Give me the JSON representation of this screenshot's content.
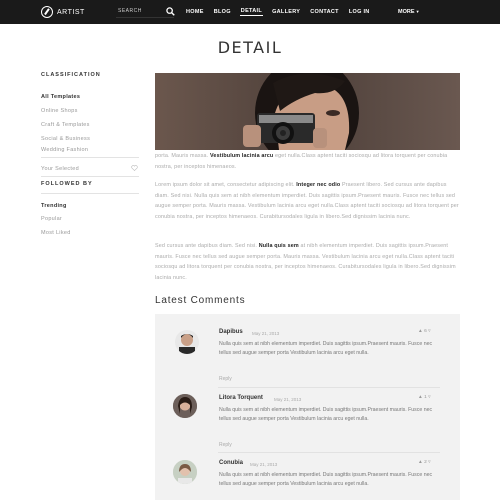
{
  "header": {
    "logo_text": "ARTIST",
    "search_label": "SEARCH",
    "nav": [
      "HOME",
      "BLOG",
      "DETAIL",
      "GALLERY",
      "CONTACT",
      "LOG IN"
    ],
    "more": "MORE",
    "accent": "#1a1a1a"
  },
  "page_title": "DETAIL",
  "sidebar": {
    "classification_heading": "CLASSIFICATION",
    "classification_items": [
      "All Templates",
      "Online Shops",
      "Craft & Templates",
      "Social & Business",
      "Wedding Fashion"
    ],
    "your_selected": "Your Selected",
    "followed_heading": "FOLLOWED BY",
    "followed_items": [
      "Trending",
      "Popular",
      "Most Liked"
    ]
  },
  "article": {
    "p1_lead": "porta. Mauris massa. ",
    "p1_bold": "Vestibulum lacinia arcu",
    "p1_rest": " eget nulla.Class aptent taciti sociosqu ad litora torquent per conubia nostra, per inceptos himenaeos.",
    "p2_lead": "Lorem ipsum dolor sit amet, consectetur adipiscing elit. ",
    "p2_bold": "Integer nec odio",
    "p2_rest": " Praesent libero. Sed cursus ante dapibus diam. Sed nisi. Nulla quis sem at nibh elementum imperdiet. Duis sagittis ipsum.Praesent mauris. Fusce nec tellus sed augue semper porta. Mauris massa. Vestibulum lacinia arcu eget nulla.Class aptent taciti sociosqu ad litora torquent per conubia nostra, per inceptos himenaeos. Curabitursodales ligula in libero.Sed dignissim lacinia nunc.",
    "p3_lead": "Sed cursus ante dapibus diam. Sed nisi. ",
    "p3_bold": "Nulla quis sem",
    "p3_rest": " at nibh elementum imperdiet. Duis sagittis ipsum.Praesent mauris. Fusce nec tellus sed augue semper porta. Mauris massa. Vestibulum lacinia arcu eget nulla.Class aptent taciti sociosqu ad litora torquent per conubia nostra, per inceptos himenaeos. Curabitursodales ligula in libero.Sed dignissim lacinia nunc."
  },
  "comments": {
    "title": "Latest Comments",
    "items": [
      {
        "name": "Dapibus",
        "date": "May 21, 2013",
        "votes": "6",
        "text": "Nulla quis sem at nibh elementum imperdiet. Duis sagittis ipsum.Praesent mauris. Fusce nec tellus sed augue semper porta Vestibulum lacinia arcu eget nulla.",
        "reply": "Reply"
      },
      {
        "name": "Litora Torquent",
        "date": "May 21, 2013",
        "votes": "1",
        "text": "Nulla quis sem at nibh elementum imperdiet. Duis sagittis ipsum.Praesent mauris. Fusce nec tellus sed augue semper porta Vestibulum lacinia arcu eget nulla.",
        "reply": "Reply"
      },
      {
        "name": "Conubia",
        "date": "May 21, 2013",
        "votes": "2",
        "text": "Nulla quis sem at nibh elementum imperdiet. Duis sagittis ipsum.Praesent mauris. Fusce nec tellus sed augue semper porta Vestibulum lacinia arcu eget nulla.",
        "reply": ""
      }
    ]
  }
}
